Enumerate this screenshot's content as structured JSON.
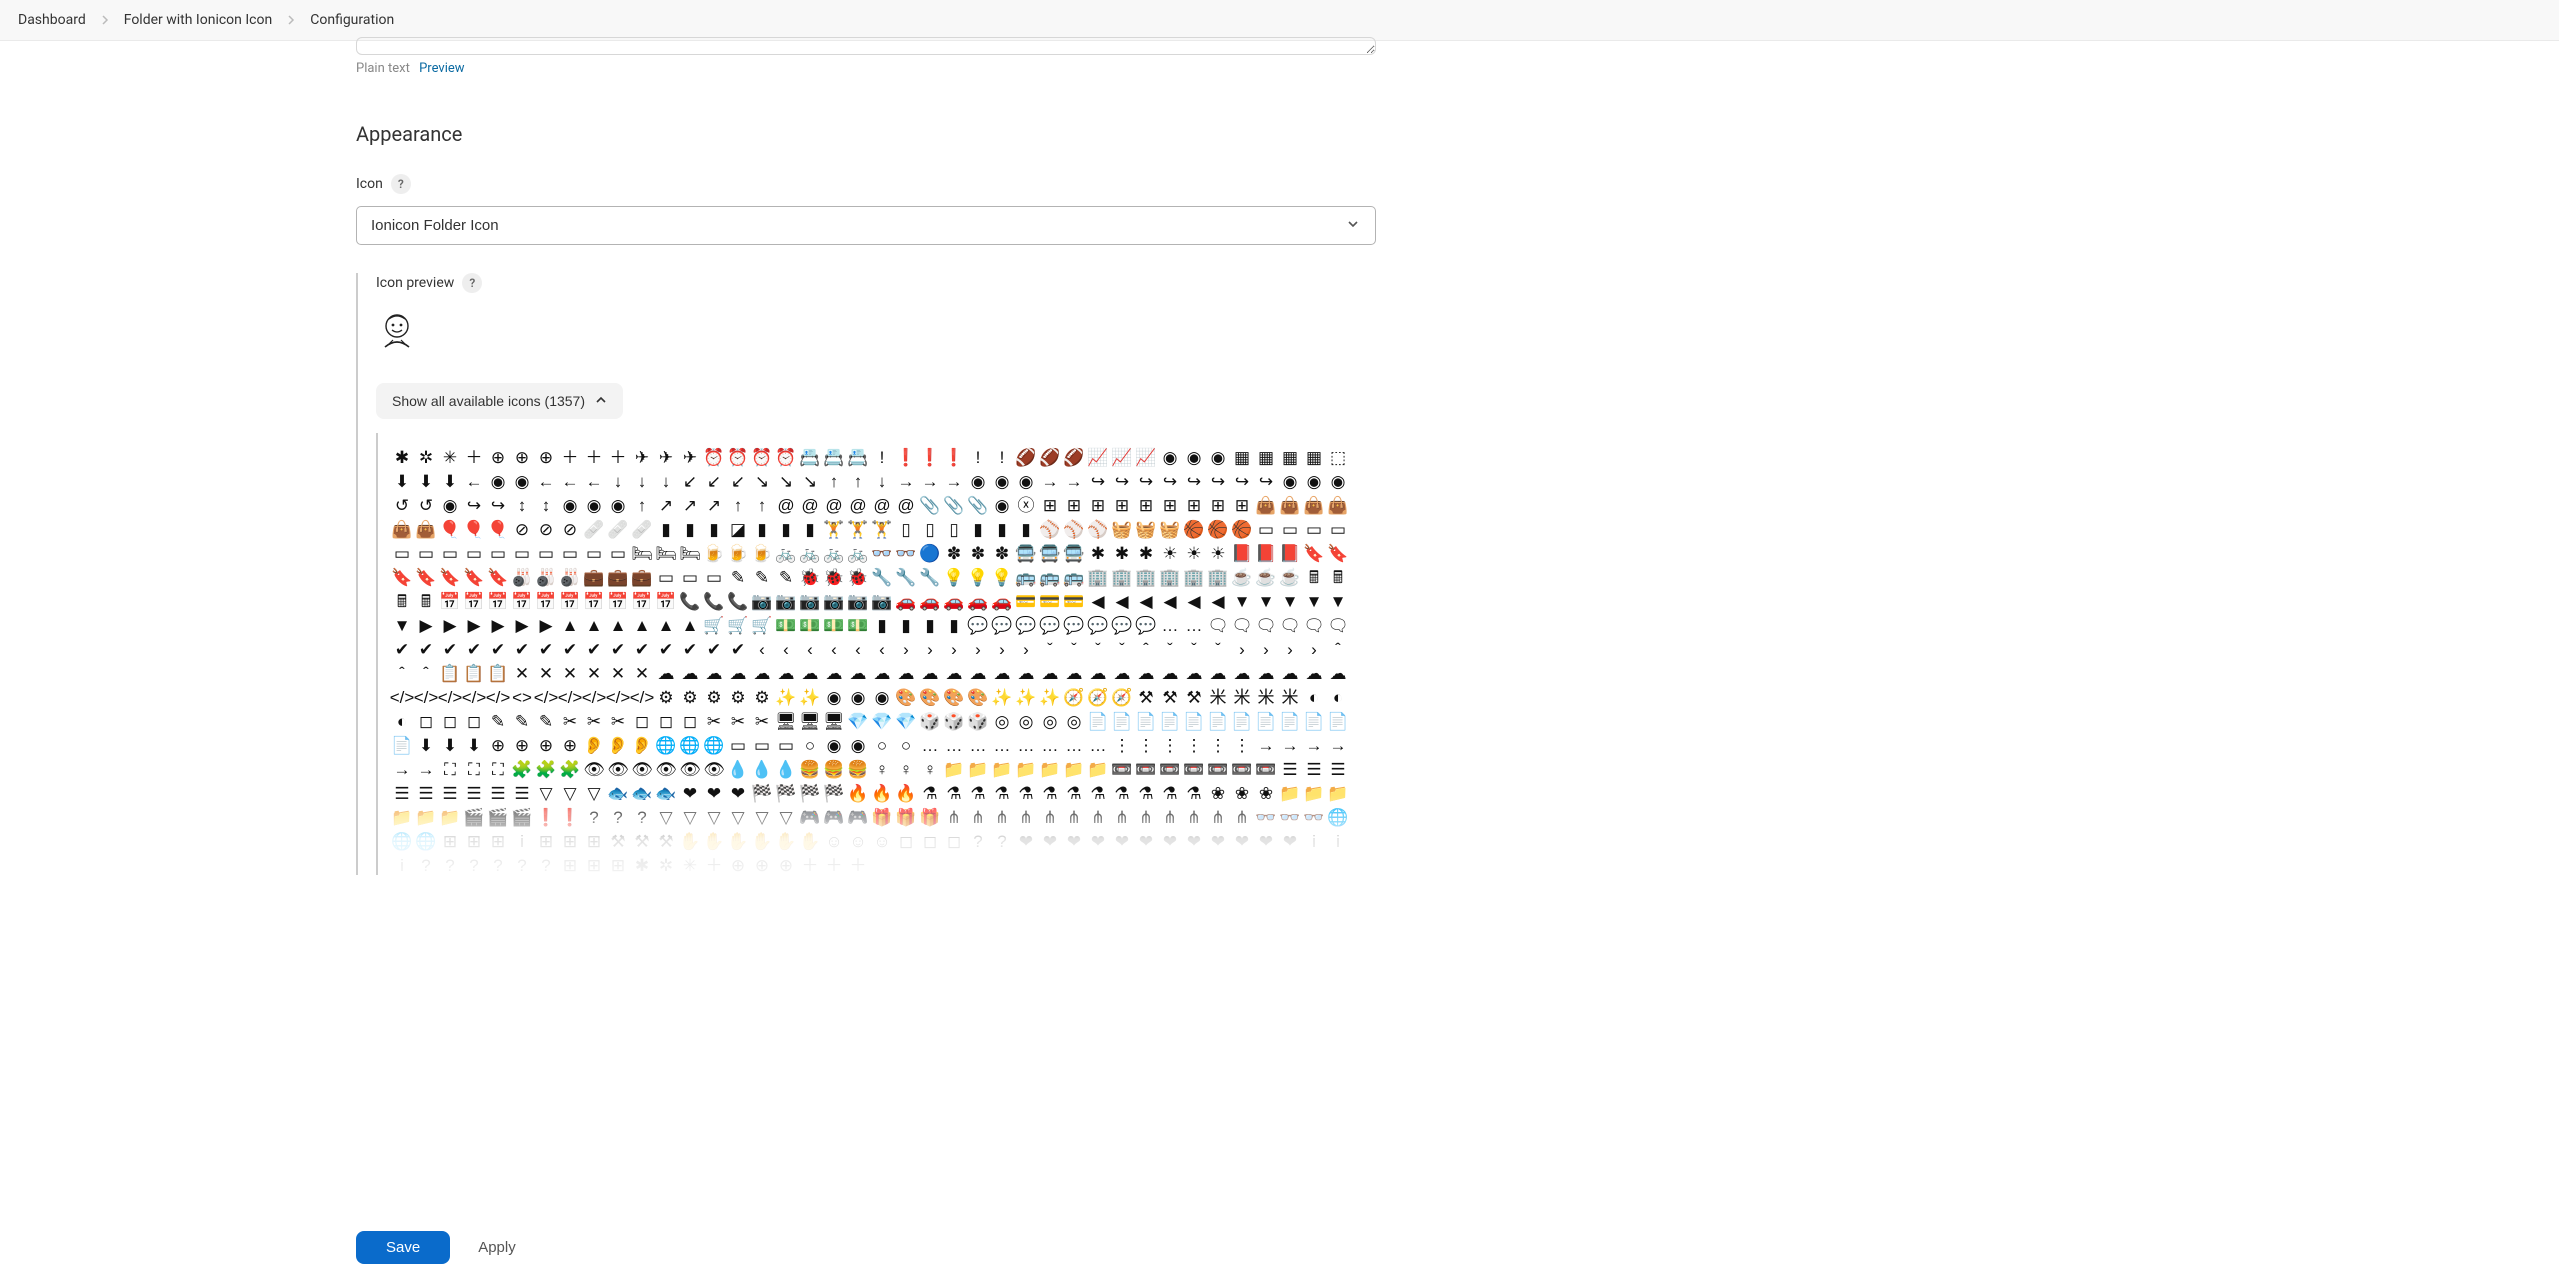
{
  "breadcrumb": {
    "items": [
      {
        "label": "Dashboard"
      },
      {
        "label": "Folder with Ionicon Icon"
      },
      {
        "label": "Configuration"
      }
    ]
  },
  "description": {
    "plain_text_label": "Plain text",
    "preview_label": "Preview"
  },
  "appearance": {
    "title": "Appearance",
    "icon_label": "Icon",
    "icon_select_value": "Ionicon Folder Icon",
    "icon_preview_label": "Icon preview",
    "show_icons_label": "Show all available icons (1357)",
    "total_icons": 1357
  },
  "footer": {
    "save_label": "Save",
    "apply_label": "Apply"
  },
  "icon_glyphs": [
    "✱",
    "✲",
    "✳",
    "＋",
    "⊕",
    "⊕",
    "⊕",
    "＋",
    "＋",
    "＋",
    "✈",
    "✈",
    "✈",
    "⏰",
    "⏰",
    "⏰",
    "⏰",
    "📇",
    "📇",
    "📇",
    "!",
    "❗",
    "❗",
    "❗",
    "!",
    "!",
    "🏈",
    "🏈",
    "🏈",
    "📈",
    "📈",
    "📈",
    "◉",
    "◉",
    "◉",
    "▦",
    "▦",
    "▦",
    "▦",
    "⬚",
    "⬇",
    "⬇",
    "⬇",
    "←",
    "◉",
    "◉",
    "←",
    "←",
    "←",
    "↓",
    "↓",
    "↓",
    "↙",
    "↙",
    "↙",
    "↘",
    "↘",
    "↘",
    "↑",
    "↑",
    "↓",
    "→",
    "→",
    "→",
    "◉",
    "◉",
    "◉",
    "→",
    "→",
    "↪",
    "↪",
    "↪",
    "↪",
    "↪",
    "↪",
    "↪",
    "↪",
    "◉",
    "◉",
    "◉",
    "↺",
    "↺",
    "◉",
    "↪",
    "↪",
    "↕",
    "↕",
    "◉",
    "◉",
    "◉",
    "↑",
    "↗",
    "↗",
    "↗",
    "↑",
    "↑",
    "@",
    "@",
    "@",
    "@",
    "@",
    "@",
    "📎",
    "📎",
    "📎",
    "◉",
    "ⓧ",
    "⊞",
    "⊞",
    "⊞",
    "⊞",
    "⊞",
    "⊞",
    "⊞",
    "⊞",
    "⊞",
    "👜",
    "👜",
    "👜",
    "👜",
    "👜",
    "👜",
    "🎈",
    "🎈",
    "🎈",
    "⊘",
    "⊘",
    "⊘",
    "🩹",
    "🩹",
    "🩹",
    "▮",
    "▮",
    "▮",
    "◪",
    "▮",
    "▮",
    "▮",
    "🏋",
    "🏋",
    "🏋",
    "▯",
    "▯",
    "▯",
    "▮",
    "▮",
    "▮",
    "⚾",
    "⚾",
    "⚾",
    "🧺",
    "🧺",
    "🧺",
    "🏀",
    "🏀",
    "🏀",
    "▭",
    "▭",
    "▭",
    "▭",
    "▭",
    "▭",
    "▭",
    "▭",
    "▭",
    "▭",
    "▭",
    "▭",
    "▭",
    "▭",
    "🛏",
    "🛏",
    "🛏",
    "🍺",
    "🍺",
    "🍺",
    "🚲",
    "🚲",
    "🚲",
    "🚲",
    "👓",
    "👓",
    "🔵",
    "✽",
    "✽",
    "✽",
    "🚍",
    "🚍",
    "🚍",
    "✱",
    "✱",
    "✱",
    "☀",
    "☀",
    "☀",
    "📕",
    "📕",
    "📕",
    "🔖",
    "🔖",
    "🔖",
    "🔖",
    "🔖",
    "🔖",
    "🔖",
    "🎳",
    "🎳",
    "🎳",
    "💼",
    "💼",
    "💼",
    "▭",
    "▭",
    "▭",
    "✎",
    "✎",
    "✎",
    "🐞",
    "🐞",
    "🐞",
    "🔧",
    "🔧",
    "🔧",
    "💡",
    "💡",
    "💡",
    "🚌",
    "🚌",
    "🚌",
    "🏢",
    "🏢",
    "🏢",
    "🏢",
    "🏢",
    "🏢",
    "☕",
    "☕",
    "☕",
    "🖩",
    "🖩",
    "🖩",
    "🖩",
    "📅",
    "📅",
    "📅",
    "📅",
    "📅",
    "📅",
    "📅",
    "📅",
    "📅",
    "📅",
    "📞",
    "📞",
    "📞",
    "📷",
    "📷",
    "📷",
    "📷",
    "📷",
    "📷",
    "🚗",
    "🚗",
    "🚗",
    "🚗",
    "🚗",
    "💳",
    "💳",
    "💳",
    "◀",
    "◀",
    "◀",
    "◀",
    "◀",
    "◀",
    "▼",
    "▼",
    "▼",
    "▼",
    "▼",
    "▼",
    "▶",
    "▶",
    "▶",
    "▶",
    "▶",
    "▶",
    "▲",
    "▲",
    "▲",
    "▲",
    "▲",
    "▲",
    "🛒",
    "🛒",
    "🛒",
    "💵",
    "💵",
    "💵",
    "💵",
    "▮",
    "▮",
    "▮",
    "▮",
    "💬",
    "💬",
    "💬",
    "💬",
    "💬",
    "💬",
    "💬",
    "💬",
    "…",
    "…",
    "🗨",
    "🗨",
    "🗨",
    "🗨",
    "🗨",
    "🗨",
    "✔",
    "✔",
    "✔",
    "✔",
    "✔",
    "✔",
    "✔",
    "✔",
    "✔",
    "✔",
    "✔",
    "✔",
    "✔",
    "✔",
    "✔",
    "‹",
    "‹",
    "‹",
    "‹",
    "‹",
    "‹",
    "›",
    "›",
    "›",
    "›",
    "›",
    "›",
    "ˇ",
    "ˇ",
    "ˇ",
    "ˇ",
    "ˆ",
    "ˇ",
    "ˇ",
    "ˇ",
    "›",
    "›",
    "›",
    "›",
    "ˆ",
    "ˆ",
    "ˆ",
    "📋",
    "📋",
    "📋",
    "✕",
    "✕",
    "✕",
    "✕",
    "✕",
    "✕",
    "☁",
    "☁",
    "☁",
    "☁",
    "☁",
    "☁",
    "☁",
    "☁",
    "☁",
    "☁",
    "☁",
    "☁",
    "☁",
    "☁",
    "☁",
    "☁",
    "☁",
    "☁",
    "☁",
    "☁",
    "☁",
    "☁",
    "☁",
    "☁",
    "☁",
    "☁",
    "☁",
    "☁",
    "☁",
    "</>",
    "</>",
    "</>",
    "</>",
    "</>",
    "<>",
    "</>",
    "</>",
    "</>",
    "</>",
    "</>",
    "⚙",
    "⚙",
    "⚙",
    "⚙",
    "⚙",
    "✨",
    "✨",
    "◉",
    "◉",
    "◉",
    "🎨",
    "🎨",
    "🎨",
    "🎨",
    "✨",
    "✨",
    "✨",
    "🧭",
    "🧭",
    "🧭",
    "⚒",
    "⚒",
    "⚒",
    "米",
    "米",
    "米",
    "米",
    "◐",
    "◐",
    "◐",
    "◻",
    "◻",
    "◻",
    "✎",
    "✎",
    "✎",
    "✂",
    "✂",
    "✂",
    "◻",
    "◻",
    "◻",
    "✂",
    "✂",
    "✂",
    "🖥",
    "🖥",
    "🖥",
    "💎",
    "💎",
    "💎",
    "🎲",
    "🎲",
    "🎲",
    "◎",
    "◎",
    "◎",
    "◎",
    "📄",
    "📄",
    "📄",
    "📄",
    "📄",
    "📄",
    "📄",
    "📄",
    "📄",
    "📄",
    "📄",
    "📄",
    "⬇",
    "⬇",
    "⬇",
    "⊕",
    "⊕",
    "⊕",
    "⊕",
    "👂",
    "👂",
    "👂",
    "🌐",
    "🌐",
    "🌐",
    "▭",
    "▭",
    "▭",
    "○",
    "◉",
    "◉",
    "○",
    "○",
    "…",
    "…",
    "…",
    "…",
    "…",
    "…",
    "…",
    "…",
    "⋮",
    "⋮",
    "⋮",
    "⋮",
    "⋮",
    "⋮",
    "→",
    "→",
    "→",
    "→",
    "→",
    "→",
    "⛶",
    "⛶",
    "⛶",
    "🧩",
    "🧩",
    "🧩",
    "👁",
    "👁",
    "👁",
    "👁",
    "👁",
    "👁",
    "💧",
    "💧",
    "💧",
    "🍔",
    "🍔",
    "🍔",
    "♀",
    "♀",
    "♀",
    "📁",
    "📁",
    "📁",
    "📁",
    "📁",
    "📁",
    "📁",
    "📼",
    "📼",
    "📼",
    "📼",
    "📼",
    "📼",
    "📼",
    "☰",
    "☰",
    "☰",
    "☰",
    "☰",
    "☰",
    "☰",
    "☰",
    "☰",
    "▽",
    "▽",
    "▽",
    "🐟",
    "🐟",
    "🐟",
    "❤",
    "❤",
    "❤",
    "🏁",
    "🏁",
    "🏁",
    "🏁",
    "🔥",
    "🔥",
    "🔥",
    "⚗",
    "⚗",
    "⚗",
    "⚗",
    "⚗",
    "⚗",
    "⚗",
    "⚗",
    "⚗",
    "⚗",
    "⚗",
    "⚗",
    "❀",
    "❀",
    "❀",
    "📁",
    "📁",
    "📁",
    "📁",
    "📁",
    "📁",
    "🎬",
    "🎬",
    "🎬",
    "❗",
    "❗",
    "?",
    "?",
    "?",
    "▽",
    "▽",
    "▽",
    "▽",
    "▽",
    "▽",
    "🎮",
    "🎮",
    "🎮",
    "🎁",
    "🎁",
    "🎁",
    "⋔",
    "⋔",
    "⋔",
    "⋔",
    "⋔",
    "⋔",
    "⋔",
    "⋔",
    "⋔",
    "⋔",
    "⋔",
    "⋔",
    "⋔",
    "👓",
    "👓",
    "👓",
    "🌐",
    "🌐",
    "🌐",
    "⊞",
    "⊞",
    "⊞",
    "i",
    "⊞",
    "⊞",
    "⊞",
    "⚒",
    "⚒",
    "⚒",
    "✋",
    "✋",
    "✋",
    "✋",
    "✋",
    "✋",
    "☺",
    "☺",
    "☺",
    "◻",
    "◻",
    "◻",
    "?",
    "?",
    "❤",
    "❤",
    "❤",
    "❤",
    "❤",
    "❤",
    "❤",
    "❤",
    "❤",
    "❤",
    "❤",
    "❤",
    "i",
    "i",
    "i",
    "?",
    "?",
    "?",
    "?",
    "?",
    "?",
    "⊞",
    "⊞",
    "⊞"
  ]
}
